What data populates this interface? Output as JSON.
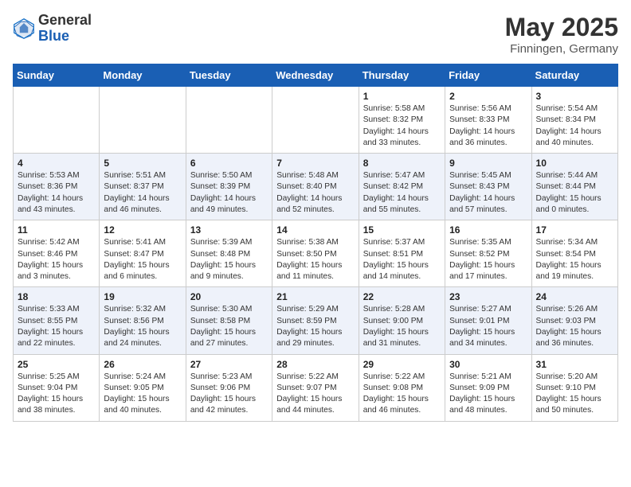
{
  "header": {
    "logo_general": "General",
    "logo_blue": "Blue",
    "month_title": "May 2025",
    "location": "Finningen, Germany"
  },
  "weekdays": [
    "Sunday",
    "Monday",
    "Tuesday",
    "Wednesday",
    "Thursday",
    "Friday",
    "Saturday"
  ],
  "weeks": [
    [
      {
        "day": "",
        "info": ""
      },
      {
        "day": "",
        "info": ""
      },
      {
        "day": "",
        "info": ""
      },
      {
        "day": "",
        "info": ""
      },
      {
        "day": "1",
        "info": "Sunrise: 5:58 AM\nSunset: 8:32 PM\nDaylight: 14 hours\nand 33 minutes."
      },
      {
        "day": "2",
        "info": "Sunrise: 5:56 AM\nSunset: 8:33 PM\nDaylight: 14 hours\nand 36 minutes."
      },
      {
        "day": "3",
        "info": "Sunrise: 5:54 AM\nSunset: 8:34 PM\nDaylight: 14 hours\nand 40 minutes."
      }
    ],
    [
      {
        "day": "4",
        "info": "Sunrise: 5:53 AM\nSunset: 8:36 PM\nDaylight: 14 hours\nand 43 minutes."
      },
      {
        "day": "5",
        "info": "Sunrise: 5:51 AM\nSunset: 8:37 PM\nDaylight: 14 hours\nand 46 minutes."
      },
      {
        "day": "6",
        "info": "Sunrise: 5:50 AM\nSunset: 8:39 PM\nDaylight: 14 hours\nand 49 minutes."
      },
      {
        "day": "7",
        "info": "Sunrise: 5:48 AM\nSunset: 8:40 PM\nDaylight: 14 hours\nand 52 minutes."
      },
      {
        "day": "8",
        "info": "Sunrise: 5:47 AM\nSunset: 8:42 PM\nDaylight: 14 hours\nand 55 minutes."
      },
      {
        "day": "9",
        "info": "Sunrise: 5:45 AM\nSunset: 8:43 PM\nDaylight: 14 hours\nand 57 minutes."
      },
      {
        "day": "10",
        "info": "Sunrise: 5:44 AM\nSunset: 8:44 PM\nDaylight: 15 hours\nand 0 minutes."
      }
    ],
    [
      {
        "day": "11",
        "info": "Sunrise: 5:42 AM\nSunset: 8:46 PM\nDaylight: 15 hours\nand 3 minutes."
      },
      {
        "day": "12",
        "info": "Sunrise: 5:41 AM\nSunset: 8:47 PM\nDaylight: 15 hours\nand 6 minutes."
      },
      {
        "day": "13",
        "info": "Sunrise: 5:39 AM\nSunset: 8:48 PM\nDaylight: 15 hours\nand 9 minutes."
      },
      {
        "day": "14",
        "info": "Sunrise: 5:38 AM\nSunset: 8:50 PM\nDaylight: 15 hours\nand 11 minutes."
      },
      {
        "day": "15",
        "info": "Sunrise: 5:37 AM\nSunset: 8:51 PM\nDaylight: 15 hours\nand 14 minutes."
      },
      {
        "day": "16",
        "info": "Sunrise: 5:35 AM\nSunset: 8:52 PM\nDaylight: 15 hours\nand 17 minutes."
      },
      {
        "day": "17",
        "info": "Sunrise: 5:34 AM\nSunset: 8:54 PM\nDaylight: 15 hours\nand 19 minutes."
      }
    ],
    [
      {
        "day": "18",
        "info": "Sunrise: 5:33 AM\nSunset: 8:55 PM\nDaylight: 15 hours\nand 22 minutes."
      },
      {
        "day": "19",
        "info": "Sunrise: 5:32 AM\nSunset: 8:56 PM\nDaylight: 15 hours\nand 24 minutes."
      },
      {
        "day": "20",
        "info": "Sunrise: 5:30 AM\nSunset: 8:58 PM\nDaylight: 15 hours\nand 27 minutes."
      },
      {
        "day": "21",
        "info": "Sunrise: 5:29 AM\nSunset: 8:59 PM\nDaylight: 15 hours\nand 29 minutes."
      },
      {
        "day": "22",
        "info": "Sunrise: 5:28 AM\nSunset: 9:00 PM\nDaylight: 15 hours\nand 31 minutes."
      },
      {
        "day": "23",
        "info": "Sunrise: 5:27 AM\nSunset: 9:01 PM\nDaylight: 15 hours\nand 34 minutes."
      },
      {
        "day": "24",
        "info": "Sunrise: 5:26 AM\nSunset: 9:03 PM\nDaylight: 15 hours\nand 36 minutes."
      }
    ],
    [
      {
        "day": "25",
        "info": "Sunrise: 5:25 AM\nSunset: 9:04 PM\nDaylight: 15 hours\nand 38 minutes."
      },
      {
        "day": "26",
        "info": "Sunrise: 5:24 AM\nSunset: 9:05 PM\nDaylight: 15 hours\nand 40 minutes."
      },
      {
        "day": "27",
        "info": "Sunrise: 5:23 AM\nSunset: 9:06 PM\nDaylight: 15 hours\nand 42 minutes."
      },
      {
        "day": "28",
        "info": "Sunrise: 5:22 AM\nSunset: 9:07 PM\nDaylight: 15 hours\nand 44 minutes."
      },
      {
        "day": "29",
        "info": "Sunrise: 5:22 AM\nSunset: 9:08 PM\nDaylight: 15 hours\nand 46 minutes."
      },
      {
        "day": "30",
        "info": "Sunrise: 5:21 AM\nSunset: 9:09 PM\nDaylight: 15 hours\nand 48 minutes."
      },
      {
        "day": "31",
        "info": "Sunrise: 5:20 AM\nSunset: 9:10 PM\nDaylight: 15 hours\nand 50 minutes."
      }
    ]
  ]
}
